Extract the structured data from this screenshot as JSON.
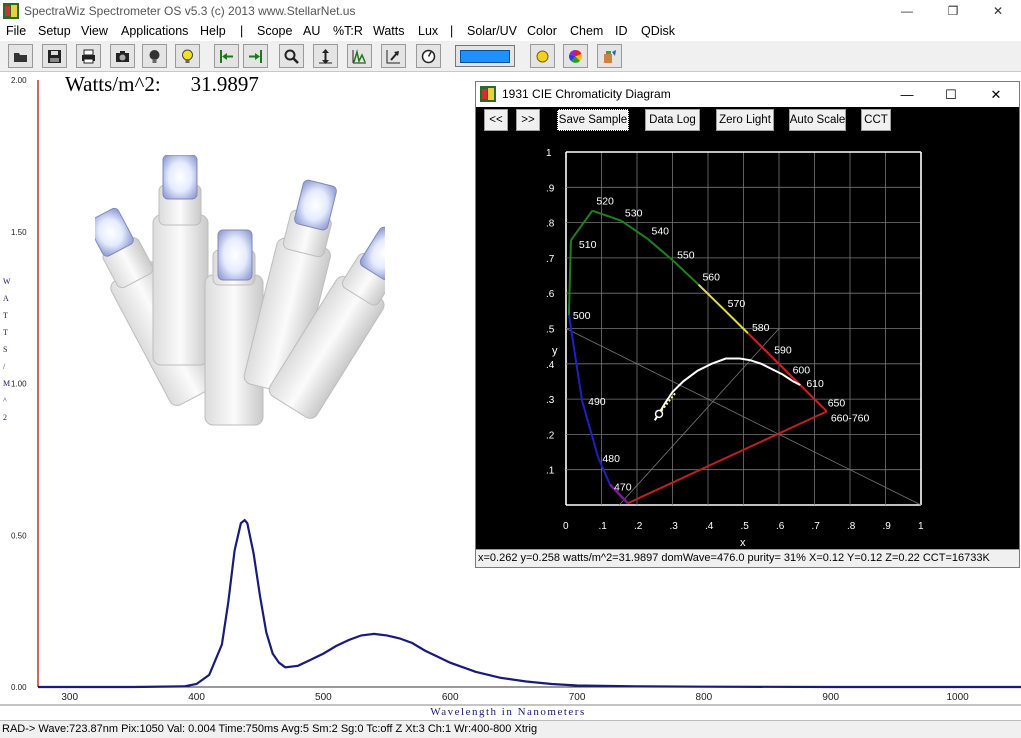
{
  "app": {
    "title": "SpectraWiz  Spectrometer OS v5.3 (c) 2013    www.StellarNet.us",
    "window_controls": {
      "minimize": "—",
      "restore": "❐",
      "close": "✕"
    }
  },
  "menu": [
    "File",
    "Setup",
    "View",
    "Applications",
    "Help",
    "|",
    "Scope",
    "AU",
    "%T:R",
    "Watts",
    "Lux",
    "|",
    "Solar/UV",
    "Color",
    "Chem",
    "ID",
    "QDisk"
  ],
  "toolbar": {
    "icons": [
      "open-icon",
      "save-icon",
      "print-icon",
      "camera-icon",
      "bulb-dark-icon",
      "bulb-light-icon",
      "scroll-left-icon",
      "scroll-right-icon",
      "zoom-icon",
      "autoscale-icon",
      "peaks-icon",
      "export-icon",
      "timer-icon",
      "color-bar-icon",
      "sun-icon",
      "color-wheel-icon",
      "paint-icon"
    ]
  },
  "readout": {
    "label": "Watts/m^2:",
    "value": "31.9897"
  },
  "spectrum_chart": {
    "y_axis_title": "W A T T S / M ^ 2",
    "x_axis_title": "Wavelength in Nanometers",
    "colors": {
      "curve": "#1a1a7a",
      "left_axis": "#c01010"
    }
  },
  "chart_data": [
    {
      "type": "line",
      "xlabel": "Wavelength in Nanometers",
      "ylabel": "WATTS/M^2",
      "xlim": [
        275,
        1050
      ],
      "ylim": [
        0,
        2.0
      ],
      "x_ticks": [
        300,
        400,
        500,
        600,
        700,
        800,
        900,
        1000
      ],
      "y_ticks": [
        "0.00",
        "0.50",
        "1.00",
        "1.50",
        "2.00"
      ],
      "grid": false,
      "series": [
        {
          "x": [
            275,
            300,
            350,
            390,
            400,
            410,
            420,
            425,
            430,
            435,
            438,
            440,
            445,
            450,
            455,
            460,
            465,
            470,
            480,
            490,
            500,
            510,
            520,
            530,
            540,
            550,
            560,
            570,
            580,
            590,
            600,
            620,
            640,
            660,
            680,
            700,
            750,
            800,
            900,
            1050
          ],
          "values": [
            0.0,
            0.0,
            0.0,
            0.002,
            0.01,
            0.04,
            0.14,
            0.28,
            0.45,
            0.54,
            0.55,
            0.54,
            0.44,
            0.3,
            0.18,
            0.11,
            0.08,
            0.065,
            0.07,
            0.09,
            0.11,
            0.135,
            0.155,
            0.17,
            0.175,
            0.17,
            0.16,
            0.145,
            0.12,
            0.1,
            0.08,
            0.05,
            0.03,
            0.018,
            0.01,
            0.005,
            0.002,
            0.001,
            0.0,
            0.0
          ]
        }
      ]
    },
    {
      "type": "scatter",
      "xlabel": "x",
      "ylabel": "y",
      "xlim": [
        0,
        1
      ],
      "ylim": [
        0,
        1
      ],
      "x_ticks": [
        "0",
        ".1",
        ".2",
        ".3",
        ".4",
        ".5",
        ".6",
        ".7",
        ".8",
        ".9",
        "1"
      ],
      "y_ticks": [
        ".1",
        ".2",
        ".3",
        ".4",
        ".5",
        ".6",
        ".7",
        ".8",
        ".9",
        "1"
      ],
      "grid": true,
      "series": [
        {
          "x": [
            0.262
          ],
          "values": [
            0.258
          ]
        }
      ],
      "wavelength_labels": [
        "470",
        "480",
        "490",
        "500",
        "510",
        "520",
        "530",
        "540",
        "550",
        "560",
        "570",
        "580",
        "590",
        "600",
        "610",
        "650",
        "660-760"
      ],
      "locus": {
        "x": [
          0.1241,
          0.0913,
          0.0454,
          0.0082,
          0.0139,
          0.0743,
          0.1547,
          0.2296,
          0.3016,
          0.3731,
          0.4441,
          0.5125,
          0.5752,
          0.627,
          0.6658,
          0.726,
          0.7347
        ],
        "y": [
          0.0578,
          0.1327,
          0.295,
          0.5384,
          0.7502,
          0.8338,
          0.8059,
          0.7543,
          0.6923,
          0.6245,
          0.5547,
          0.4866,
          0.4242,
          0.3725,
          0.334,
          0.274,
          0.2653
        ]
      },
      "planckian": {
        "x": [
          0.25,
          0.265,
          0.28,
          0.3,
          0.33,
          0.37,
          0.41,
          0.45,
          0.49,
          0.52,
          0.55,
          0.58,
          0.61,
          0.64,
          0.66
        ],
        "y": [
          0.24,
          0.265,
          0.29,
          0.32,
          0.35,
          0.38,
          0.4,
          0.415,
          0.415,
          0.41,
          0.4,
          0.385,
          0.37,
          0.35,
          0.34
        ]
      }
    }
  ],
  "cie_window": {
    "title": "1931 CIE Chromaticity Diagram",
    "controls": {
      "minimize": "—",
      "maximize": "☐",
      "close": "✕"
    },
    "buttons": [
      "<<",
      ">>",
      "Save Sample",
      "Data Log",
      "Zero Light",
      "Auto Scale",
      "CCT"
    ],
    "axis_labels": {
      "x": "x",
      "y": "y"
    },
    "status": "x=0.262 y=0.258 watts/m^2=31.9897  domWave=476.0  purity= 31%  X=0.12  Y=0.12  Z=0.22  CCT=16733K"
  },
  "statusbar": "RAD->  Wave:723.87nm  Pix:1050  Val:  0.004  Time:750ms  Avg:5  Sm:2  Sg:0  Tc:off  Z  Xt:3  Ch:1  Wr:400-800  Xtrig"
}
